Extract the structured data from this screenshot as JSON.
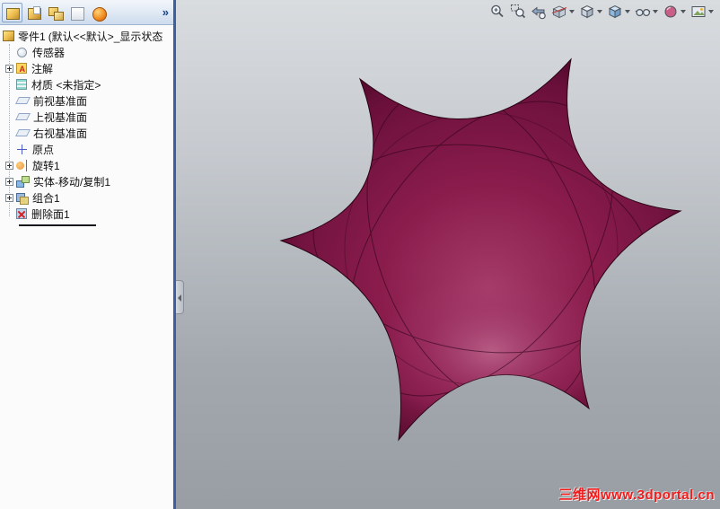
{
  "panel_toolbar": {
    "buttons": [
      {
        "id": "part-document",
        "name": "part-document-icon"
      },
      {
        "id": "open-document",
        "name": "open-document-icon"
      },
      {
        "id": "assembly-document",
        "name": "assembly-document-icon"
      },
      {
        "id": "drawing-document",
        "name": "drawing-document-icon"
      },
      {
        "id": "resources",
        "name": "solidworks-resources-icon"
      }
    ],
    "overflow_label": "»"
  },
  "feature_tree": {
    "root": {
      "label": "零件1",
      "suffix": "(默认<<默认>_显示状态"
    },
    "items": [
      {
        "id": "sensors",
        "label": "传感器",
        "expandable": false
      },
      {
        "id": "annotations",
        "label": "注解",
        "expandable": true
      },
      {
        "id": "material",
        "label": "材质 <未指定>",
        "expandable": false
      },
      {
        "id": "front-plane",
        "label": "前视基准面",
        "expandable": false
      },
      {
        "id": "top-plane",
        "label": "上视基准面",
        "expandable": false
      },
      {
        "id": "right-plane",
        "label": "右视基准面",
        "expandable": false
      },
      {
        "id": "origin",
        "label": "原点",
        "expandable": false
      },
      {
        "id": "revolve1",
        "label": "旋转1",
        "expandable": true
      },
      {
        "id": "move-copy1",
        "label": "实体-移动/复制1",
        "expandable": true
      },
      {
        "id": "combine1",
        "label": "组合1",
        "expandable": true
      },
      {
        "id": "delete-face1",
        "label": "删除面1",
        "expandable": false
      }
    ]
  },
  "viewport": {
    "hud_toolbar": [
      {
        "id": "zoom-in-out",
        "caret": false
      },
      {
        "id": "zoom-area",
        "caret": false
      },
      {
        "id": "previous-view",
        "caret": false
      },
      {
        "id": "section-view",
        "caret": true
      },
      {
        "id": "view-orientation",
        "caret": true
      },
      {
        "id": "display-style",
        "caret": true
      },
      {
        "id": "hide-show",
        "caret": true
      },
      {
        "id": "appearance",
        "caret": true
      },
      {
        "id": "scene",
        "caret": true
      }
    ],
    "watermark": "三维网www.3dportal.cn",
    "colors": {
      "model_base": "#8a1c4c",
      "model_dark": "#470523",
      "model_highlight": "#b8608a",
      "background_top": "#d9dcdf",
      "background_bottom": "#989ea4",
      "splitter_blue": "#3b5fa0",
      "watermark_red": "#f51a1a"
    }
  }
}
